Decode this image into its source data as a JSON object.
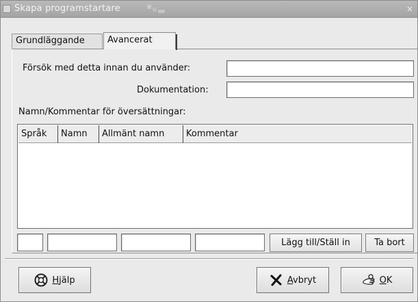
{
  "window": {
    "title": "Skapa programstartare",
    "close_glyph": "×"
  },
  "tabs": [
    {
      "label": "Grundläggande",
      "active": false
    },
    {
      "label": "Avancerat",
      "active": true
    }
  ],
  "advanced": {
    "try_label": "Försök med detta innan du använder:",
    "try_value": "",
    "doc_label": "Dokumentation:",
    "doc_value": "",
    "translations_label": "Namn/Kommentar för översättningar:",
    "columns": [
      "Språk",
      "Namn",
      "Allmänt namn",
      "Kommentar"
    ],
    "rows": [],
    "new_lang": "",
    "new_name": "",
    "new_generic": "",
    "new_comment": "",
    "add_button": "Lägg till/Ställ in",
    "remove_button": "Ta bort"
  },
  "buttons": {
    "help_mnemonic": "H",
    "help_rest": "jälp",
    "cancel_mnemonic": "A",
    "cancel_rest": "vbryt",
    "ok_mnemonic": "O",
    "ok_rest": "K"
  },
  "icons": {
    "help": "lifebuoy-icon",
    "cancel": "cancel-x-icon",
    "ok": "ok-hand-icon"
  }
}
